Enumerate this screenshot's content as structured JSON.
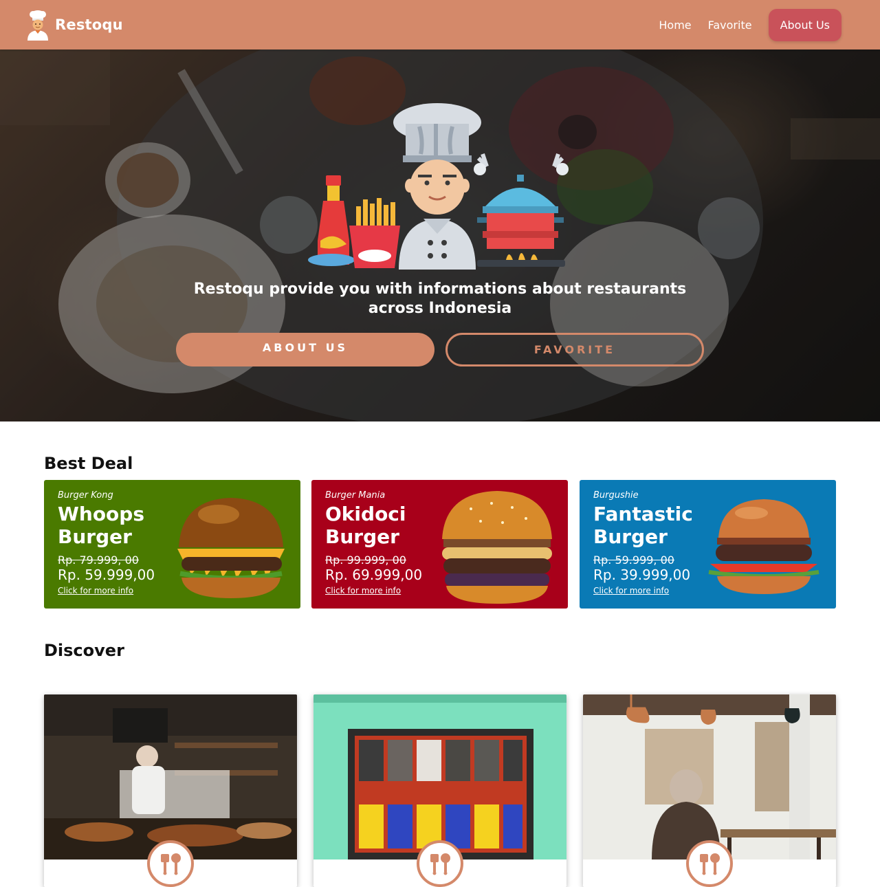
{
  "navbar": {
    "brand_name": "Restoqu",
    "links": [
      {
        "label": "Home"
      },
      {
        "label": "Favorite"
      },
      {
        "label": "About Us"
      }
    ]
  },
  "hero": {
    "tagline": "Restoqu provide you with informations about restaurants across Indonesia",
    "about_button": "ABOUT US",
    "favorite_button": "FAVORITE"
  },
  "best_deal": {
    "title": "Best Deal",
    "deals": [
      {
        "restaurant": "Burger Kong",
        "name": "Whoops Burger",
        "old_price": "Rp. 79.999, 00",
        "new_price": "Rp. 59.999,00",
        "link": "Click for more info",
        "bg": "#4a7a00"
      },
      {
        "restaurant": "Burger Mania",
        "name": "Okidoci Burger",
        "old_price": "Rp. 99.999, 00",
        "new_price": "Rp. 69.999,00",
        "link": "Click for more info",
        "bg": "#a8001a"
      },
      {
        "restaurant": "Burgushie",
        "name": "Fantastic Burger",
        "old_price": "Rp. 59.999, 00",
        "new_price": "Rp. 39.999,00",
        "link": "Click for more info",
        "bg": "#0a7ab5"
      }
    ]
  },
  "discover": {
    "title": "Discover",
    "card_icon": "restaurant-utensils-icon"
  },
  "colors": {
    "primary": "#d4896a",
    "accent": "#c9525a"
  }
}
